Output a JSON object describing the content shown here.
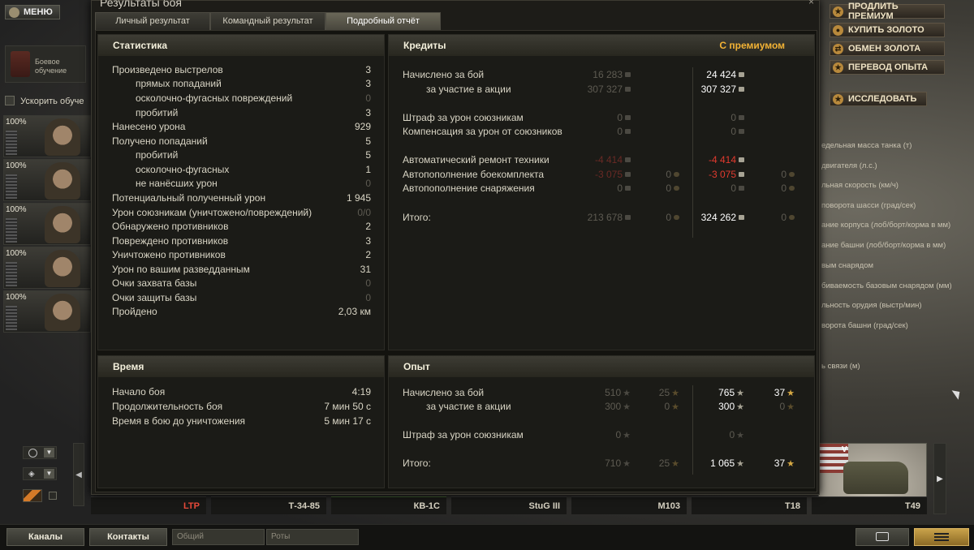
{
  "window": {
    "title": "Результаты боя",
    "close": "×",
    "tabs": [
      "Личный результат",
      "Командный результат",
      "Подробный отчёт"
    ]
  },
  "menu_label": "МЕНЮ",
  "training": {
    "line1": "Боевое",
    "line2": "обучение"
  },
  "accelerate": "Ускорить обуче",
  "crew": [
    "100%",
    "100%",
    "100%",
    "100%",
    "100%"
  ],
  "top_right": [
    "ПРОДЛИТЬ ПРЕМИУМ",
    "КУПИТЬ ЗОЛОТО",
    "ОБМЕН ЗОЛОТА",
    "ПЕРЕВОД ОПЫТА"
  ],
  "research": "ИССЛЕДОВАТЬ",
  "right_list": [
    "едельная масса танка (т)",
    "двигателя (л.с.)",
    "льная скорость (км/ч)",
    "поворота шасси (град/сек)",
    "ание корпуса (лоб/борт/корма в мм)",
    "ание башни (лоб/борт/корма в мм)",
    "вым снарядом",
    "биваемость базовым снарядом (мм)",
    "льность орудия (выстр/мин)",
    "ворота башни (град/сек)",
    "ь связи (м)"
  ],
  "tank_flag_letter": "V",
  "vehicles": [
    "LTP",
    "Т-34-85",
    "КВ-1С",
    "StuG III",
    "M103",
    "T18",
    "T49"
  ],
  "bottom": {
    "channels": "Каналы",
    "contacts": "Контакты",
    "general": "Общий",
    "rota": "Роты"
  },
  "statistics": {
    "title": "Статистика",
    "rows": [
      {
        "label": "Произведено выстрелов",
        "value": "3",
        "indent": false,
        "dim": false
      },
      {
        "label": "прямых попаданий",
        "value": "3",
        "indent": true,
        "dim": false
      },
      {
        "label": "осколочно-фугасных повреждений",
        "value": "0",
        "indent": true,
        "dim": true
      },
      {
        "label": "пробитий",
        "value": "3",
        "indent": true,
        "dim": false
      },
      {
        "label": "Нанесено урона",
        "value": "929",
        "indent": false,
        "dim": false
      },
      {
        "label": "Получено попаданий",
        "value": "5",
        "indent": false,
        "dim": false
      },
      {
        "label": "пробитий",
        "value": "5",
        "indent": true,
        "dim": false
      },
      {
        "label": "осколочно-фугасных",
        "value": "1",
        "indent": true,
        "dim": false
      },
      {
        "label": "не нанёсших урон",
        "value": "0",
        "indent": true,
        "dim": true
      },
      {
        "label": "Потенциальный полученный урон",
        "value": "1 945",
        "indent": false,
        "dim": false
      },
      {
        "label": "Урон союзникам (уничтожено/повреждений)",
        "value": "0/0",
        "indent": false,
        "dim": true
      },
      {
        "label": "Обнаружено противников",
        "value": "2",
        "indent": false,
        "dim": false
      },
      {
        "label": "Повреждено противников",
        "value": "3",
        "indent": false,
        "dim": false
      },
      {
        "label": "Уничтожено противников",
        "value": "2",
        "indent": false,
        "dim": false
      },
      {
        "label": "Урон по вашим разведданным",
        "value": "31",
        "indent": false,
        "dim": false
      },
      {
        "label": "Очки захвата базы",
        "value": "0",
        "indent": false,
        "dim": true
      },
      {
        "label": "Очки защиты базы",
        "value": "0",
        "indent": false,
        "dim": true
      },
      {
        "label": "Пройдено",
        "value": "2,03 км",
        "indent": false,
        "dim": false
      }
    ]
  },
  "time": {
    "title": "Время",
    "rows": [
      {
        "label": "Начало боя",
        "value": "4:19"
      },
      {
        "label": "Продолжительность боя",
        "value": "7 мин 50 с"
      },
      {
        "label": "Время в бою до уничтожения",
        "value": "5 мин 17 с"
      }
    ]
  },
  "credits": {
    "title": "Кредиты",
    "premium_label": "С премиумом",
    "rows": [
      {
        "label": "Начислено за бой",
        "indent": false,
        "c": "16 283",
        "g": "",
        "pc": "24 424",
        "pg": "",
        "cs": "dim",
        "pcs": "bright"
      },
      {
        "label": "за участие в акции",
        "indent": true,
        "c": "307 327",
        "g": "",
        "pc": "307 327",
        "pg": "",
        "cs": "dim",
        "pcs": "bright"
      },
      {
        "label": "Штраф за урон союзникам",
        "indent": false,
        "c": "0",
        "g": "",
        "pc": "0",
        "pg": "",
        "cs": "dim",
        "pcs": "dim"
      },
      {
        "label": "Компенсация за урон от союзников",
        "indent": false,
        "c": "0",
        "g": "",
        "pc": "0",
        "pg": "",
        "cs": "dim",
        "pcs": "dim"
      },
      {
        "label": "Автоматический ремонт техники",
        "indent": false,
        "c": "-4 414",
        "g": "",
        "pc": "-4 414",
        "pg": "",
        "cs": "dimred",
        "pcs": "red"
      },
      {
        "label": "Автопополнение боекомплекта",
        "indent": false,
        "c": "-3 075",
        "g": "0",
        "pc": "-3 075",
        "pg": "0",
        "cs": "dimred",
        "pcs": "red"
      },
      {
        "label": "Автопополнение снаряжения",
        "indent": false,
        "c": "0",
        "g": "0",
        "pc": "0",
        "pg": "0",
        "cs": "dim",
        "pcs": "dim"
      },
      {
        "label": "Итого:",
        "indent": false,
        "c": "213 678",
        "g": "0",
        "pc": "324 262",
        "pg": "0",
        "cs": "dim",
        "pcs": "bright"
      }
    ]
  },
  "experience": {
    "title": "Опыт",
    "rows": [
      {
        "label": "Начислено за бой",
        "indent": false,
        "x": "510",
        "f": "25",
        "px": "765",
        "pf": "37",
        "pxs": "bright",
        "pfs": "bright"
      },
      {
        "label": "за участие в акции",
        "indent": true,
        "x": "300",
        "f": "0",
        "px": "300",
        "pf": "0",
        "pxs": "bright",
        "pfs": "dim"
      },
      {
        "label": "Штраф за урон союзникам",
        "indent": false,
        "x": "0",
        "f": "",
        "px": "0",
        "pf": "",
        "pxs": "dim",
        "pfs": "dim"
      },
      {
        "label": "Итого:",
        "indent": false,
        "x": "710",
        "f": "25",
        "px": "1 065",
        "pf": "37",
        "pxs": "bright",
        "pfs": "bright"
      }
    ]
  }
}
